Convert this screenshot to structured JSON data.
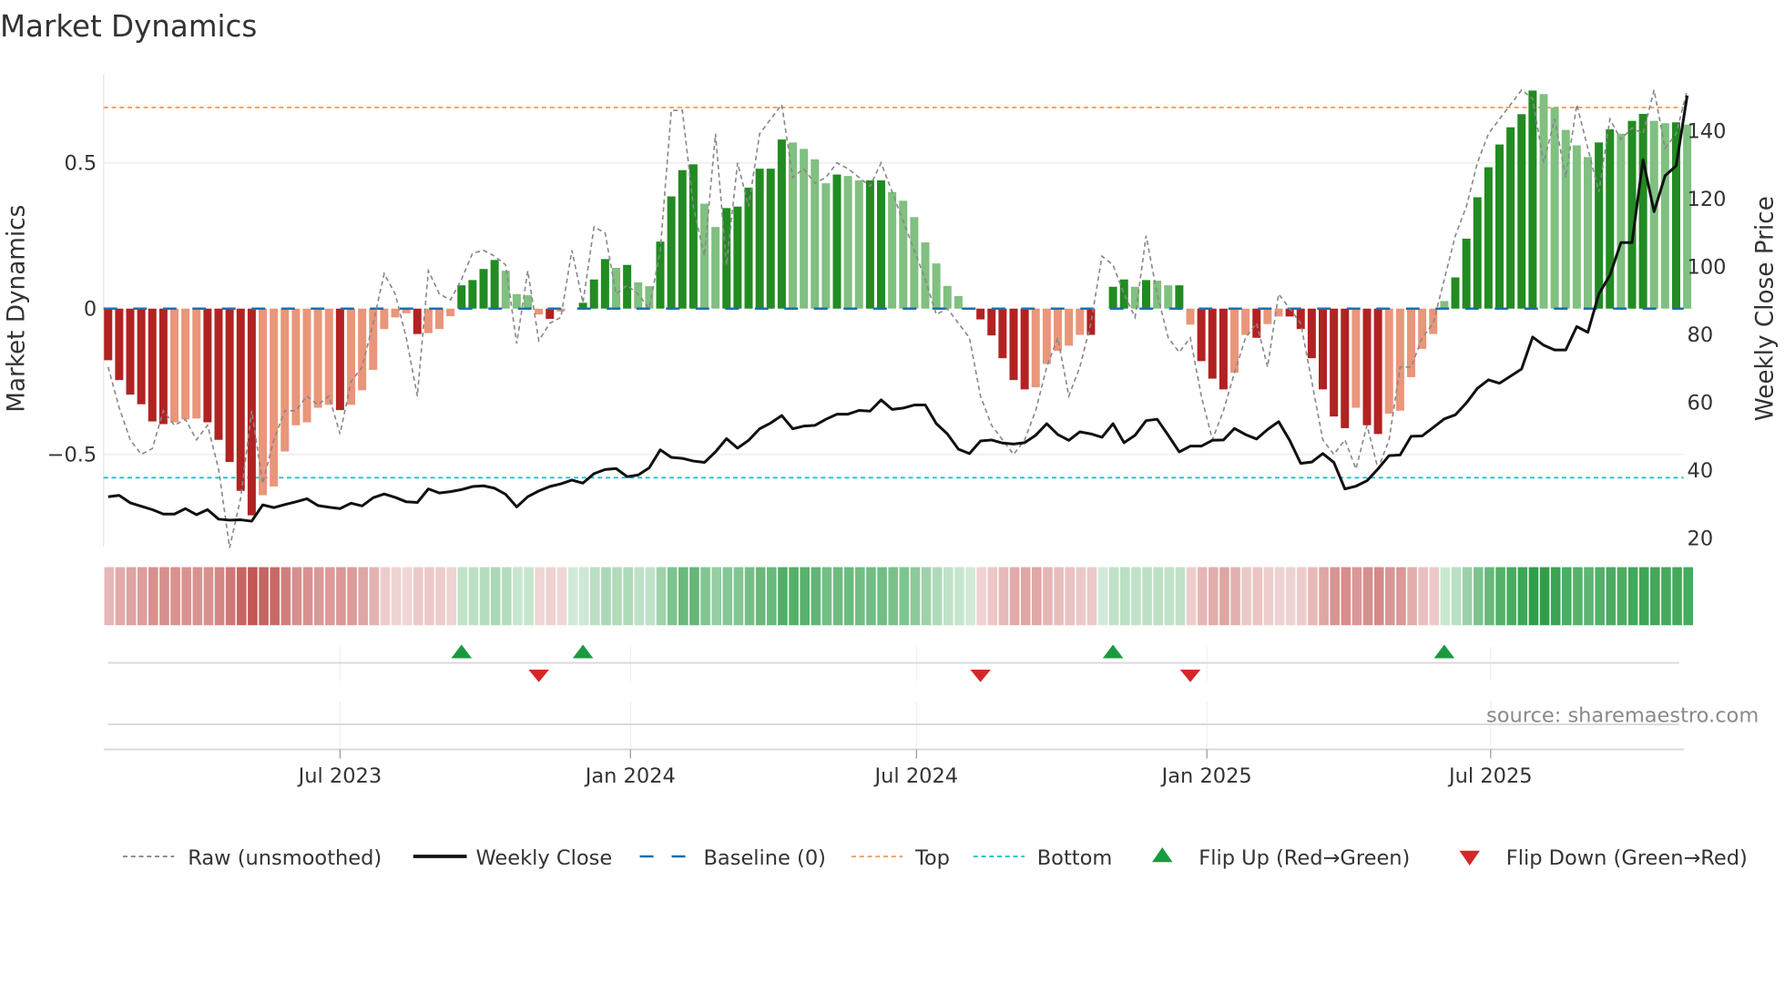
{
  "chart_data": {
    "type": "bar",
    "title": "Market Dynamics",
    "ylabel": "Market Dynamics",
    "y2label": "Weekly Close Price",
    "ylim": [
      -0.82,
      0.82
    ],
    "y2lim": [
      18,
      158
    ],
    "y_ticks": [
      {
        "label": "0.5",
        "value": 0.5
      },
      {
        "label": "0",
        "value": 0
      },
      {
        "label": "−0.5",
        "value": -0.5
      }
    ],
    "y2_ticks": [
      {
        "label": "20",
        "value": 20
      },
      {
        "label": "40",
        "value": 40
      },
      {
        "label": "60",
        "value": 60
      },
      {
        "label": "80",
        "value": 80
      },
      {
        "label": "100",
        "value": 100
      },
      {
        "label": "120",
        "value": 120
      },
      {
        "label": "140",
        "value": 140
      }
    ],
    "x_ticks": [
      {
        "label": "Jul 2023",
        "week": 21
      },
      {
        "label": "Jan 2024",
        "week": 47.3
      },
      {
        "label": "Jul 2024",
        "week": 73.2
      },
      {
        "label": "Jan 2025",
        "week": 99.5
      },
      {
        "label": "Jul 2025",
        "week": 125.2
      }
    ],
    "top_level": 0.69,
    "bottom_level": -0.58,
    "baseline": 0,
    "colors": {
      "strong_red": "#b22222",
      "weak_red": "#e9967a",
      "strong_green": "#228b22",
      "weak_green": "#80c080",
      "top": "#f0a060",
      "bottom": "#20c0d0",
      "baseline": "#1f6fa8",
      "flip_up": "#1a9a40",
      "flip_down": "#d62728",
      "raw": "#888888",
      "close": "#111111"
    },
    "values": [
      -0.177,
      -0.245,
      -0.295,
      -0.328,
      -0.387,
      -0.396,
      -0.39,
      -0.38,
      -0.377,
      -0.39,
      -0.45,
      -0.526,
      -0.625,
      -0.709,
      -0.64,
      -0.61,
      -0.49,
      -0.4,
      -0.39,
      -0.34,
      -0.33,
      -0.348,
      -0.33,
      -0.28,
      -0.21,
      -0.07,
      -0.03,
      -0.016,
      -0.087,
      -0.084,
      -0.07,
      -0.026,
      0.08,
      0.098,
      0.136,
      0.167,
      0.13,
      0.05,
      0.046,
      -0.02,
      -0.035,
      -0.01,
      0,
      0.02,
      0.1,
      0.17,
      0.14,
      0.15,
      0.09,
      0.077,
      0.23,
      0.385,
      0.475,
      0.495,
      0.36,
      0.28,
      0.345,
      0.35,
      0.415,
      0.48,
      0.48,
      0.58,
      0.57,
      0.548,
      0.512,
      0.43,
      0.46,
      0.455,
      0.44,
      0.44,
      0.44,
      0.4,
      0.37,
      0.314,
      0.227,
      0.155,
      0.078,
      0.043,
      0,
      -0.037,
      -0.092,
      -0.17,
      -0.245,
      -0.277,
      -0.27,
      -0.19,
      -0.145,
      -0.127,
      -0.09,
      -0.09,
      0,
      0.075,
      0.1,
      0.075,
      0.098,
      0.096,
      0.08,
      0.08,
      -0.055,
      -0.18,
      -0.24,
      -0.277,
      -0.22,
      -0.09,
      -0.1,
      -0.053,
      -0.027,
      -0.027,
      -0.07,
      -0.17,
      -0.277,
      -0.37,
      -0.41,
      -0.34,
      -0.4,
      -0.43,
      -0.36,
      -0.35,
      -0.235,
      -0.138,
      -0.087,
      0.026,
      0.107,
      0.24,
      0.382,
      0.485,
      0.563,
      0.622,
      0.667,
      0.748,
      0.736,
      0.69,
      0.613,
      0.56,
      0.52,
      0.57,
      0.615,
      0.6,
      0.644,
      0.668,
      0.644,
      0.636,
      0.639,
      0.631
    ],
    "raw": [
      -0.2,
      -0.34,
      -0.45,
      -0.5,
      -0.48,
      -0.35,
      -0.4,
      -0.38,
      -0.45,
      -0.4,
      -0.55,
      -0.82,
      -0.65,
      -0.35,
      -0.6,
      -0.45,
      -0.35,
      -0.35,
      -0.3,
      -0.33,
      -0.3,
      -0.43,
      -0.25,
      -0.2,
      -0.05,
      0.12,
      0.05,
      -0.1,
      -0.3,
      0.13,
      0.05,
      0.03,
      0.1,
      0.19,
      0.2,
      0.18,
      0.15,
      -0.12,
      0.13,
      -0.11,
      -0.05,
      -0.03,
      0.2,
      0.02,
      0.28,
      0.26,
      0.05,
      0.08,
      0.05,
      0.0,
      0.2,
      0.68,
      0.68,
      0.35,
      0.18,
      0.6,
      0.15,
      0.5,
      0.35,
      0.6,
      0.65,
      0.7,
      0.45,
      0.48,
      0.43,
      0.45,
      0.5,
      0.48,
      0.45,
      0.42,
      0.5,
      0.4,
      0.3,
      0.2,
      0.1,
      -0.02,
      0.0,
      -0.05,
      -0.1,
      -0.3,
      -0.4,
      -0.45,
      -0.5,
      -0.45,
      -0.35,
      -0.2,
      -0.1,
      -0.3,
      -0.2,
      -0.05,
      0.18,
      0.15,
      0.05,
      -0.03,
      0.25,
      0.05,
      -0.1,
      -0.15,
      -0.1,
      -0.3,
      -0.45,
      -0.35,
      -0.22,
      -0.1,
      -0.05,
      -0.2,
      0.05,
      0.0,
      -0.05,
      -0.25,
      -0.45,
      -0.5,
      -0.45,
      -0.55,
      -0.4,
      -0.55,
      -0.45,
      -0.2,
      -0.2,
      -0.1,
      -0.05,
      0.1,
      0.25,
      0.35,
      0.5,
      0.6,
      0.65,
      0.7,
      0.75,
      0.72,
      0.5,
      0.65,
      0.45,
      0.7,
      0.55,
      0.4,
      0.65,
      0.58,
      0.62,
      0.6,
      0.75,
      0.55,
      0.6,
      0.75
    ],
    "weekly_close": [
      32,
      32.4,
      30.2,
      29.2,
      28.2,
      26.9,
      26.9,
      28.5,
      26.7,
      28.2,
      25.4,
      25.1,
      25.2,
      24.8,
      29.6,
      28.8,
      29.7,
      30.5,
      31.4,
      29.4,
      28.9,
      28.5,
      30.1,
      29.3,
      31.7,
      32.8,
      31.8,
      30.5,
      30.3,
      34.3,
      33.1,
      33.5,
      34.1,
      35.0,
      35.2,
      34.5,
      32.7,
      29.0,
      32.0,
      33.7,
      35.0,
      35.8,
      36.9,
      36.0,
      38.8,
      40.0,
      40.3,
      37.9,
      38.4,
      40.5,
      45.8,
      43.6,
      43.3,
      42.5,
      42.1,
      45.2,
      49.1,
      46.3,
      48.6,
      52.0,
      53.7,
      55.9,
      52.0,
      52.8,
      53.0,
      54.8,
      56.3,
      56.3,
      57.4,
      57.2,
      60.5,
      57.7,
      58.1,
      59.0,
      59.0,
      53.5,
      50.5,
      46.0,
      44.7,
      48.4,
      48.7,
      47.8,
      47.5,
      47.9,
      50.1,
      53.5,
      50.3,
      48.6,
      51.1,
      50.5,
      49.5,
      53.5,
      47.9,
      50.1,
      54.4,
      54.8,
      50.1,
      45.2,
      46.9,
      46.9,
      48.6,
      48.7,
      52.1,
      50.3,
      49.0,
      51.8,
      54.1,
      48.6,
      41.8,
      42.2,
      44.7,
      42.1,
      34.3,
      35.1,
      36.7,
      40.2,
      44.1,
      44.3,
      49.8,
      49.9,
      52.4,
      54.9,
      56.1,
      59.6,
      63.9,
      66.4,
      65.4,
      67.5,
      69.6,
      79.0,
      76.6,
      75.2,
      75.2,
      82.1,
      80.4,
      91.7,
      97.2,
      106.8,
      106.8,
      131.2,
      115.9,
      126.5,
      129.4,
      150.1
    ],
    "flip_up_weeks": [
      32,
      43,
      91,
      121
    ],
    "flip_down_weeks": [
      39,
      79,
      98
    ],
    "legend": [
      {
        "label": "Raw (unsmoothed)",
        "icon": "dashed-gray-line"
      },
      {
        "label": "Weekly Close",
        "icon": "solid-black-line"
      },
      {
        "label": "Baseline (0)",
        "icon": "dashed-blue-line"
      },
      {
        "label": "Top",
        "icon": "dotted-orange-line"
      },
      {
        "label": "Bottom",
        "icon": "dotted-cyan-line"
      },
      {
        "label": "Flip Up (Red→Green)",
        "icon": "green-up-triangle"
      },
      {
        "label": "Flip Down (Green→Red)",
        "icon": "red-down-triangle"
      }
    ],
    "source": "source: sharemaestro.com"
  }
}
